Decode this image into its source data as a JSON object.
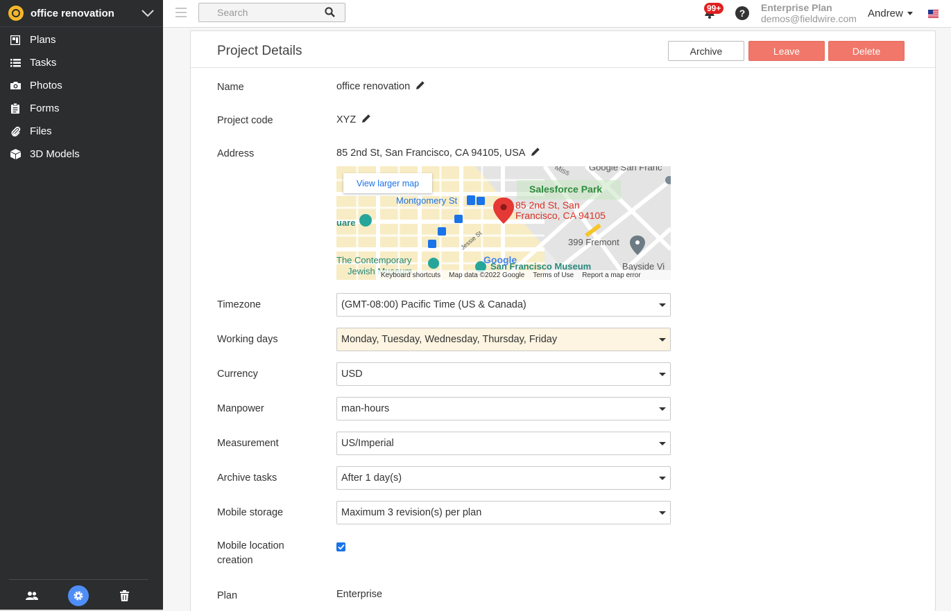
{
  "project": {
    "name": "office renovation"
  },
  "nav": [
    {
      "label": "Plans",
      "icon": "plans-icon"
    },
    {
      "label": "Tasks",
      "icon": "list-icon"
    },
    {
      "label": "Photos",
      "icon": "camera-icon"
    },
    {
      "label": "Forms",
      "icon": "clipboard-icon"
    },
    {
      "label": "Files",
      "icon": "paperclip-icon"
    },
    {
      "label": "3D Models",
      "icon": "cube-icon"
    }
  ],
  "topbar": {
    "search_placeholder": "Search",
    "notification_count": "99+",
    "help": "?",
    "plan_title": "Enterprise Plan",
    "email": "demos@fieldwire.com",
    "user": "Andrew"
  },
  "details": {
    "title": "Project Details",
    "archive_label": "Archive",
    "leave_label": "Leave",
    "delete_label": "Delete",
    "name_label": "Name",
    "name_value": "office renovation",
    "code_label": "Project code",
    "code_value": "XYZ",
    "address_label": "Address",
    "address_value": "85 2nd St, San Francisco, CA 94105, USA",
    "timezone_label": "Timezone",
    "timezone_value": "(GMT-08:00) Pacific Time (US & Canada)",
    "working_days_label": "Working days",
    "working_days_value": "Monday, Tuesday, Wednesday, Thursday, Friday",
    "currency_label": "Currency",
    "currency_value": "USD",
    "manpower_label": "Manpower",
    "manpower_value": "man-hours",
    "measurement_label": "Measurement",
    "measurement_value": "US/Imperial",
    "archive_tasks_label": "Archive tasks",
    "archive_tasks_value": "After 1 day(s)",
    "mobile_storage_label": "Mobile storage",
    "mobile_storage_value": "Maximum 3 revision(s) per plan",
    "mobile_location_label": "Mobile location creation",
    "plan_label": "Plan",
    "plan_value": "Enterprise"
  },
  "map": {
    "view_larger": "View larger map",
    "salesforce": "Salesforce Park",
    "montgomery": "Montgomery St",
    "pin_label_1": "85 2nd St, San",
    "pin_label_2": "Francisco, CA 94105",
    "fremont": "399 Fremont",
    "contemporary": "The Contemporary",
    "jewish": "Jewish Museum",
    "sfm": "San Francisco Museum",
    "bayside": "Bayside Vi",
    "square": "uare",
    "google": "Google",
    "google_top": "Google San Franc",
    "mission": "Miss",
    "jessie": "Jessie St",
    "footer_shortcuts": "Keyboard shortcuts",
    "footer_data": "Map data ©2022 Google",
    "footer_terms": "Terms of Use",
    "footer_report": "Report a map error"
  }
}
